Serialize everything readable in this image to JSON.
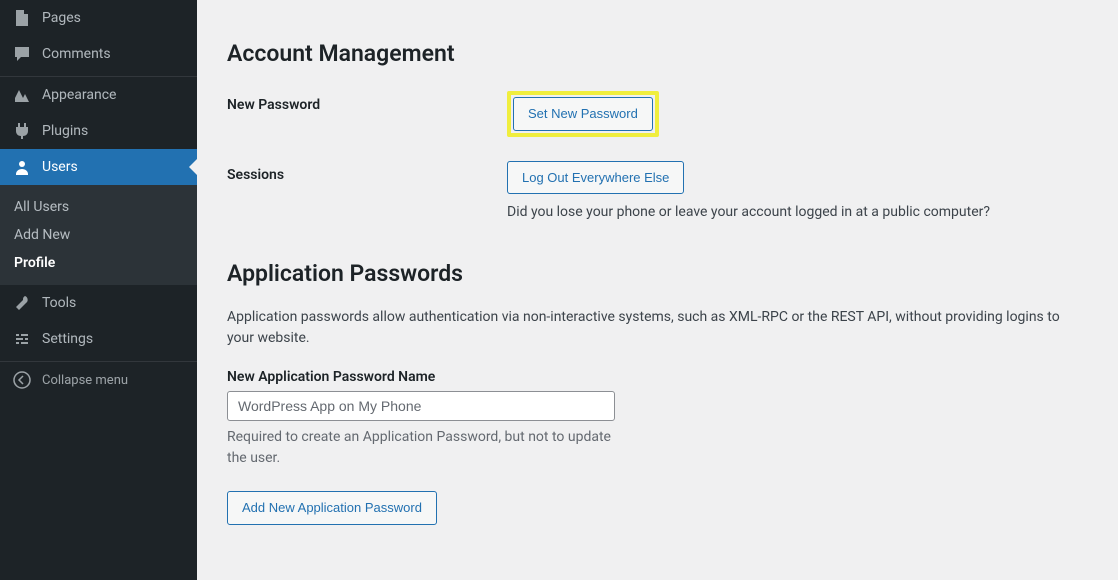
{
  "sidebar": {
    "items": [
      {
        "label": "Pages"
      },
      {
        "label": "Comments"
      },
      {
        "label": "Appearance"
      },
      {
        "label": "Plugins"
      },
      {
        "label": "Users"
      },
      {
        "label": "Tools"
      },
      {
        "label": "Settings"
      }
    ],
    "submenu": [
      {
        "label": "All Users"
      },
      {
        "label": "Add New"
      },
      {
        "label": "Profile"
      }
    ],
    "collapse": "Collapse menu"
  },
  "account": {
    "heading": "Account Management",
    "new_password_label": "New Password",
    "set_password_btn": "Set New Password",
    "sessions_label": "Sessions",
    "logout_btn": "Log Out Everywhere Else",
    "logout_desc": "Did you lose your phone or leave your account logged in at a public computer?"
  },
  "app_passwords": {
    "heading": "Application Passwords",
    "desc": "Application passwords allow authentication via non-interactive systems, such as XML-RPC or the REST API, without providing logins to your website.",
    "name_label": "New Application Password Name",
    "name_placeholder": "WordPress App on My Phone",
    "name_help": "Required to create an Application Password, but not to update the user.",
    "add_btn": "Add New Application Password"
  }
}
